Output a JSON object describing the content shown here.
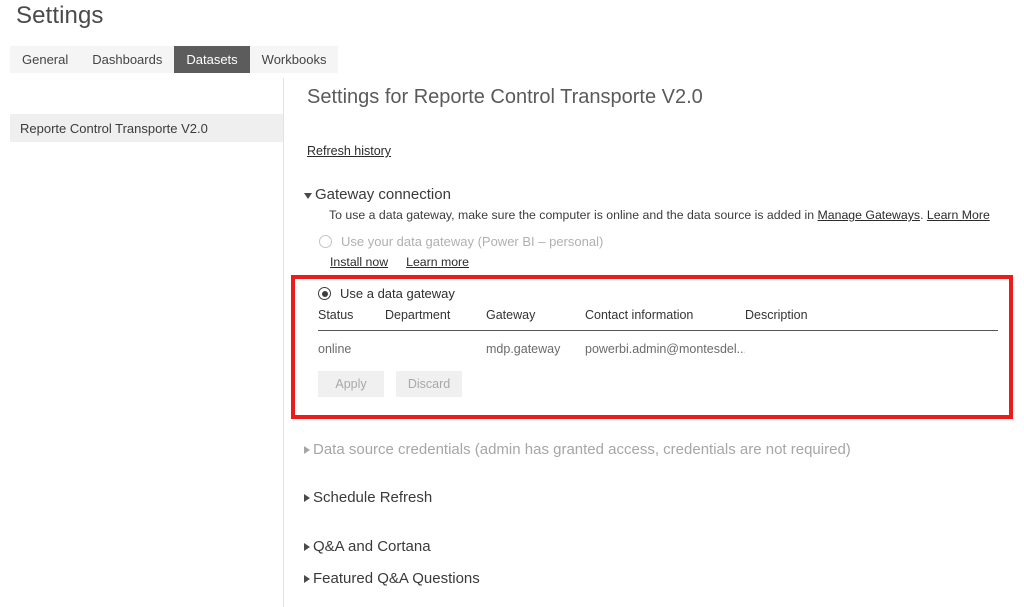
{
  "page": {
    "title": "Settings"
  },
  "tabs": [
    {
      "label": "General",
      "active": false
    },
    {
      "label": "Dashboards",
      "active": false
    },
    {
      "label": "Datasets",
      "active": true
    },
    {
      "label": "Workbooks",
      "active": false
    }
  ],
  "sidebar": {
    "items": [
      {
        "label": "Reporte Control Transporte V2.0",
        "selected": true
      }
    ]
  },
  "content": {
    "title": "Settings for Reporte Control Transporte V2.0",
    "refresh_history_link": "Refresh history",
    "gateway_section": {
      "heading": "Gateway connection",
      "expanded": true,
      "description_prefix": "To use a data gateway, make sure the computer is online and the data source is added in ",
      "manage_gateways_link": "Manage Gateways",
      "description_separator": ". ",
      "learn_more_link": "Learn More",
      "personal_gateway": {
        "label": "Use your data gateway (Power BI – personal)",
        "selected": false,
        "disabled": true,
        "install_now_link": "Install now",
        "learn_more_link": "Learn more"
      },
      "enterprise_gateway": {
        "label": "Use a data gateway",
        "selected": true
      },
      "table": {
        "columns": [
          "Status",
          "Department",
          "Gateway",
          "Contact information",
          "Description"
        ],
        "rows": [
          {
            "status": "online",
            "department": "",
            "gateway": "mdp.gateway",
            "contact": "powerbi.admin@montesdel...",
            "description": ""
          }
        ]
      },
      "apply_label": "Apply",
      "discard_label": "Discard"
    },
    "sections": [
      {
        "heading": "Data source credentials (admin has granted access, credentials are not required)",
        "expanded": false,
        "muted": true
      },
      {
        "heading": "Schedule Refresh",
        "expanded": false,
        "muted": false
      },
      {
        "heading": "Q&A and Cortana",
        "expanded": false,
        "muted": false
      },
      {
        "heading": "Featured Q&A Questions",
        "expanded": false,
        "muted": false
      }
    ]
  },
  "colors": {
    "highlight_border": "#ee1b1b",
    "active_tab_bg": "#5c5c5c",
    "tabbar_bg": "#f5f5f5"
  }
}
